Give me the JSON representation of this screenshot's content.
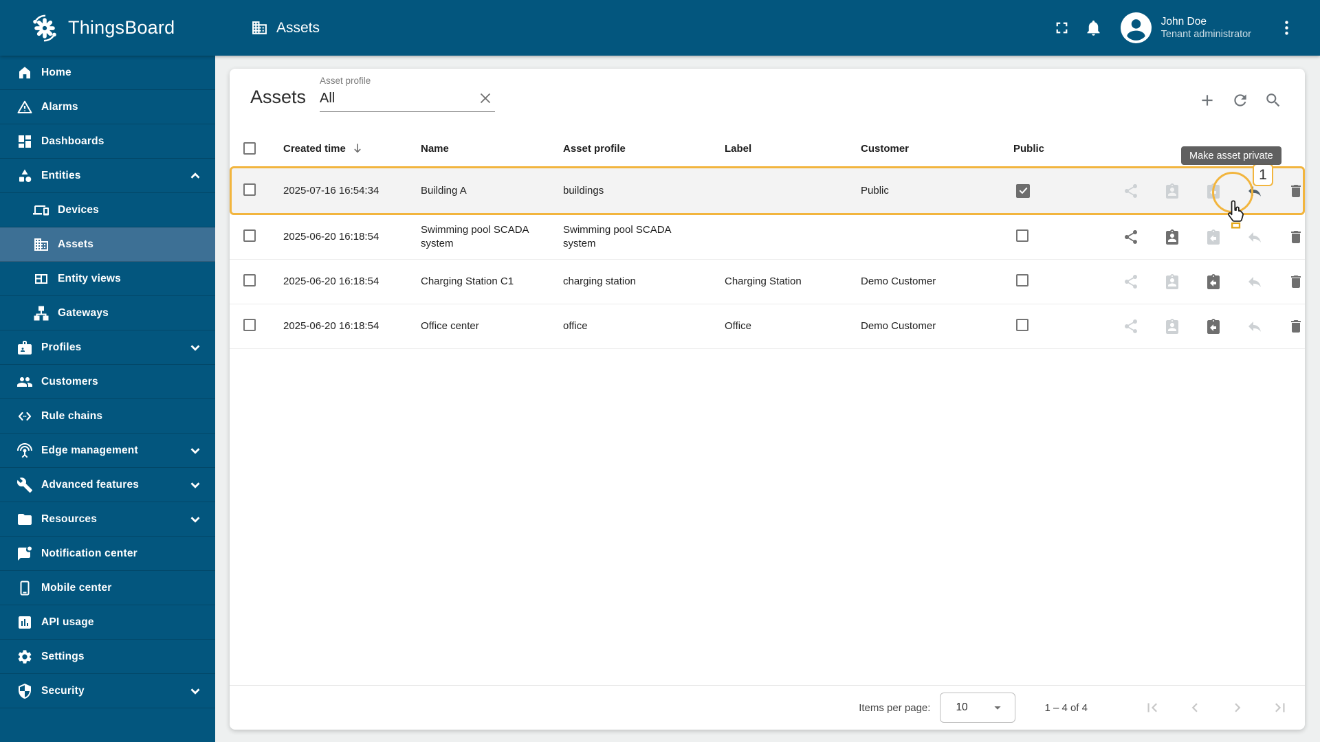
{
  "colors": {
    "primary": "#03567e",
    "selected_nav": "#3d7095",
    "accent": "#f2b53e",
    "page_bg": "#eef0f0"
  },
  "topbar": {
    "brand": "ThingsBoard",
    "breadcrumb": "Assets",
    "user_name": "John Doe",
    "user_role": "Tenant administrator",
    "icons": [
      "fullscreen-icon",
      "notifications-bell-icon",
      "avatar",
      "kebab-menu-icon"
    ]
  },
  "sidebar": {
    "items": [
      {
        "label": "Home",
        "icon": "home-icon"
      },
      {
        "label": "Alarms",
        "icon": "warning-icon"
      },
      {
        "label": "Dashboards",
        "icon": "dashboard-icon"
      },
      {
        "label": "Entities",
        "icon": "category-icon",
        "chevron": "up",
        "expanded": true
      },
      {
        "label": "Devices",
        "icon": "devices-icon",
        "sub": true
      },
      {
        "label": "Assets",
        "icon": "building-icon",
        "sub": true,
        "selected": true
      },
      {
        "label": "Entity views",
        "icon": "view-grid-icon",
        "sub": true
      },
      {
        "label": "Gateways",
        "icon": "sitemap-icon",
        "sub": true
      },
      {
        "label": "Profiles",
        "icon": "badge-icon",
        "chevron": "down"
      },
      {
        "label": "Customers",
        "icon": "people-icon"
      },
      {
        "label": "Rule chains",
        "icon": "rule-chain-icon"
      },
      {
        "label": "Edge management",
        "icon": "antenna-icon",
        "chevron": "down"
      },
      {
        "label": "Advanced features",
        "icon": "tools-icon",
        "chevron": "down"
      },
      {
        "label": "Resources",
        "icon": "folder-icon",
        "chevron": "down"
      },
      {
        "label": "Notification center",
        "icon": "chat-unread-icon"
      },
      {
        "label": "Mobile center",
        "icon": "smartphone-icon"
      },
      {
        "label": "API usage",
        "icon": "chart-box-icon"
      },
      {
        "label": "Settings",
        "icon": "gear-icon"
      },
      {
        "label": "Security",
        "icon": "shield-icon",
        "chevron": "down"
      }
    ]
  },
  "content": {
    "title": "Assets",
    "filter": {
      "label": "Asset profile",
      "value": "All"
    },
    "header_icons": [
      "add-icon",
      "refresh-icon",
      "search-icon"
    ],
    "table": {
      "columns": {
        "created": "Created time",
        "name": "Name",
        "profile": "Asset profile",
        "label": "Label",
        "customer": "Customer",
        "public": "Public"
      },
      "sort": {
        "column": "Created time",
        "direction": "desc"
      },
      "rows": [
        {
          "created": "2025-07-16 16:54:34",
          "name": "Building A",
          "profile": "buildings",
          "label": "",
          "customer": "Public",
          "public": true,
          "highlighted": true,
          "actions_enabled": {
            "share": false,
            "assign": false,
            "unassign": false,
            "make_private": true,
            "delete": true
          }
        },
        {
          "created": "2025-06-20 16:18:54",
          "name": "Swimming pool SCADA system",
          "profile": "Swimming pool SCADA system",
          "label": "",
          "customer": "",
          "public": false,
          "actions_enabled": {
            "share": true,
            "assign": true,
            "unassign": false,
            "make_private": false,
            "delete": true
          }
        },
        {
          "created": "2025-06-20 16:18:54",
          "name": "Charging Station C1",
          "profile": "charging station",
          "label": "Charging Station",
          "customer": "Demo Customer",
          "public": false,
          "actions_enabled": {
            "share": false,
            "assign": false,
            "unassign": true,
            "make_private": false,
            "delete": true
          }
        },
        {
          "created": "2025-06-20 16:18:54",
          "name": "Office center",
          "profile": "office",
          "label": "Office",
          "customer": "Demo Customer",
          "public": false,
          "actions_enabled": {
            "share": false,
            "assign": false,
            "unassign": true,
            "make_private": false,
            "delete": true
          }
        }
      ]
    },
    "tooltip": "Make asset private",
    "annotation": {
      "label": "1"
    },
    "footer": {
      "items_per_page_label": "Items per page:",
      "items_per_page_value": "10",
      "range": "1 – 4 of 4",
      "pagination_icons": [
        "first-page-icon",
        "prev-page-icon",
        "next-page-icon",
        "last-page-icon"
      ]
    }
  }
}
